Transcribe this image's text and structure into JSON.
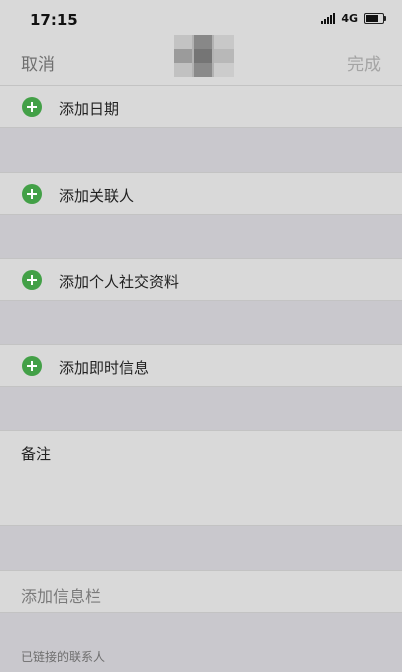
{
  "status": {
    "time": "17:15",
    "network": "4G",
    "battery_level": 0.65
  },
  "nav": {
    "cancel": "取消",
    "done": "完成"
  },
  "rows": {
    "add_date": "添加日期",
    "add_contact": "添加关联人",
    "add_social": "添加个人社交资料",
    "add_im": "添加即时信息",
    "notes": "备注",
    "add_info_bar": "添加信息栏",
    "linked_contacts": "已链接的联系人"
  }
}
